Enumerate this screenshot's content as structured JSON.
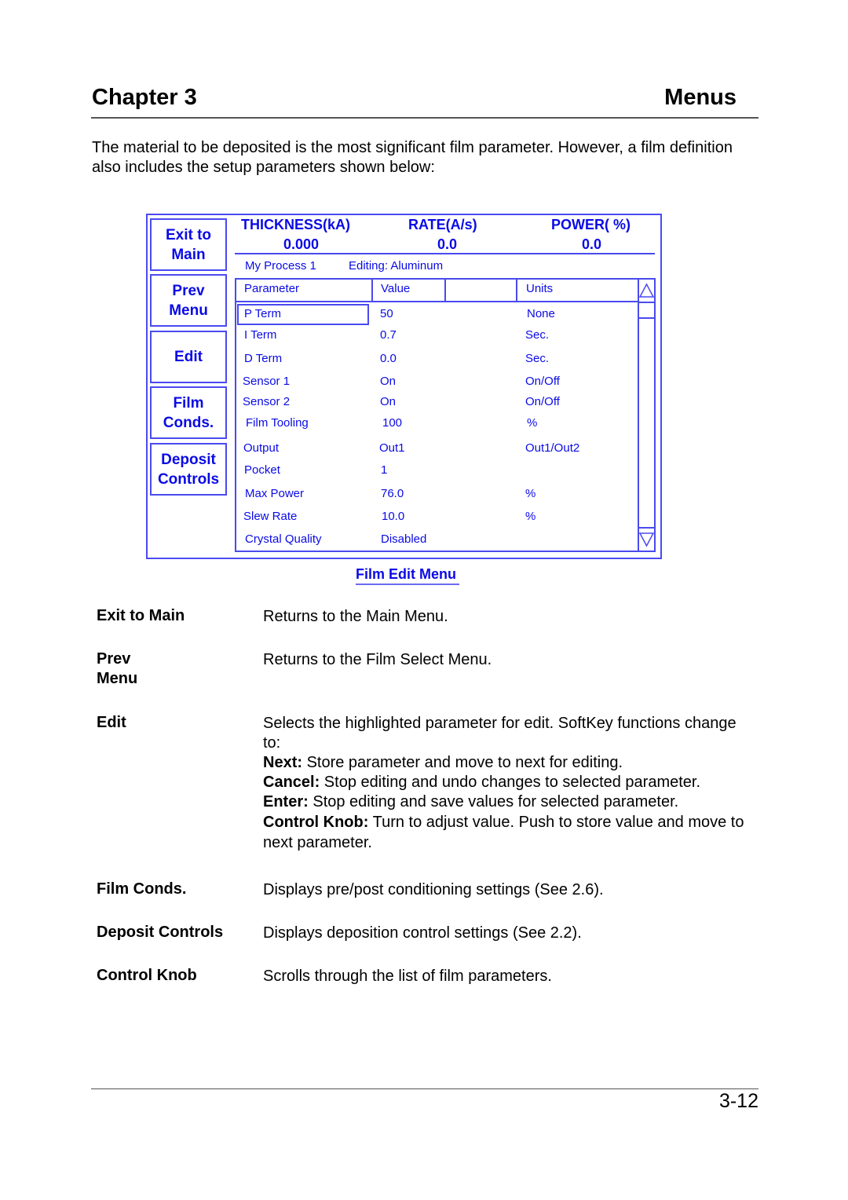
{
  "header": {
    "chapter": "Chapter 3",
    "section": "Menus"
  },
  "intro": "The material to be deposited is the most significant film parameter.  However, a film definition also includes the setup parameters shown below:",
  "screen": {
    "softkeys": [
      {
        "line1": "Exit to",
        "line2": "Main"
      },
      {
        "line1": "Prev",
        "line2": "Menu"
      },
      {
        "line1": "Edit",
        "line2": ""
      },
      {
        "line1": "Film",
        "line2": "Conds."
      },
      {
        "line1": "Deposit",
        "line2": "Controls"
      }
    ],
    "readouts": [
      {
        "label": "THICKNESS(kA)",
        "value": "0.000"
      },
      {
        "label": "RATE(A/s)",
        "value": "0.0"
      },
      {
        "label": "POWER( %)",
        "value": "0.0"
      }
    ],
    "process_name": "My Process 1",
    "editing_status": "Editing: Aluminum",
    "table": {
      "columns": [
        "Parameter",
        "Value",
        "",
        "Units"
      ],
      "selected_row": 0,
      "rows": [
        {
          "parameter": "P Term",
          "value": "50",
          "units": "None"
        },
        {
          "parameter": "I Term",
          "value": "0.7",
          "units": "Sec."
        },
        {
          "parameter": "D Term",
          "value": "0.0",
          "units": "Sec."
        },
        {
          "parameter": "Sensor 1",
          "value": "On",
          "units": "On/Off"
        },
        {
          "parameter": "Sensor 2",
          "value": "On",
          "units": "On/Off"
        },
        {
          "parameter": "Film Tooling",
          "value": "100",
          "units": "%"
        },
        {
          "parameter": "Output",
          "value": "Out1",
          "units": "Out1/Out2"
        },
        {
          "parameter": "Pocket",
          "value": "1",
          "units": ""
        },
        {
          "parameter": "Max Power",
          "value": "76.0",
          "units": "%"
        },
        {
          "parameter": "Slew Rate",
          "value": "10.0",
          "units": "%"
        },
        {
          "parameter": "Crystal Quality",
          "value": "Disabled",
          "units": ""
        }
      ]
    },
    "scroll_up_icon": "triangle-up-icon",
    "scroll_down_icon": "triangle-down-icon",
    "accent_color": "#0a0ae6"
  },
  "caption": "Film Edit Menu",
  "definitions": [
    {
      "term": "Exit to Main",
      "desc": "Returns to the Main Menu."
    },
    {
      "term": "Prev Menu",
      "term_line1": "Prev",
      "term_line2": "Menu",
      "desc": "Returns to the Film Select Menu."
    },
    {
      "term": "Edit",
      "desc": "Selects the highlighted parameter for edit.  SoftKey functions change to:",
      "items": [
        {
          "key": "Next:",
          "text": " Store parameter and move to next for editing."
        },
        {
          "key": "Cancel:",
          "text": " Stop editing and undo changes to selected parameter."
        },
        {
          "key": "Enter:",
          "text": " Stop editing and save values for selected parameter."
        },
        {
          "key": "Control Knob:",
          "text": " Turn to adjust value.  Push to store value and move to next parameter."
        }
      ]
    },
    {
      "term": "Film Conds.",
      "desc": "Displays pre/post conditioning settings (See 2.6)."
    },
    {
      "term": "Deposit Controls",
      "desc": "Displays deposition control settings (See 2.2)."
    },
    {
      "term": "Control Knob",
      "desc": "Scrolls through the list of film parameters."
    }
  ],
  "footer": {
    "page_number": "3-12"
  }
}
